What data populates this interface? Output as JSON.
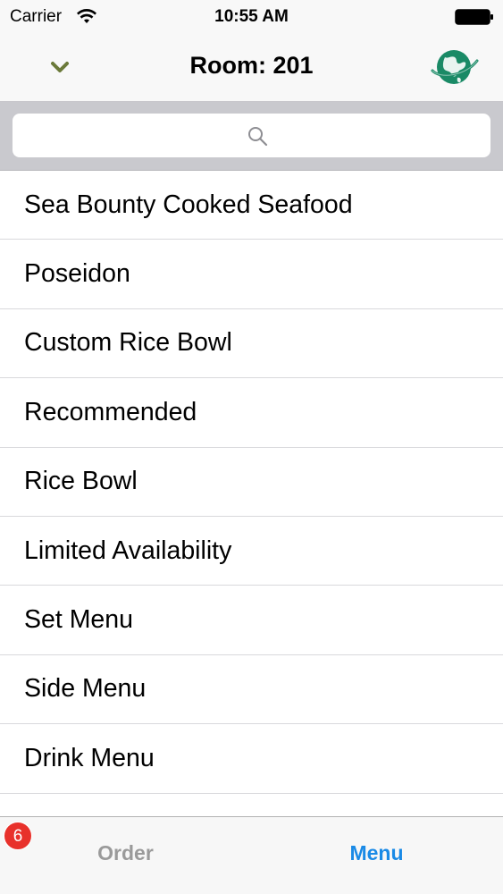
{
  "status_bar": {
    "carrier": "Carrier",
    "time": "10:55 AM",
    "wifi_icon": "wifi-icon",
    "battery_icon": "battery-icon"
  },
  "nav_bar": {
    "title": "Room: 201",
    "left_icon": "chevron-down-icon",
    "right_icon": "globe-icon",
    "chevron_color": "#6b7a3a",
    "globe_color": "#1a8a66"
  },
  "search": {
    "placeholder": "",
    "icon": "search-icon"
  },
  "menu_categories": [
    {
      "label": "Sea Bounty Cooked Seafood"
    },
    {
      "label": "Poseidon"
    },
    {
      "label": "Custom Rice Bowl"
    },
    {
      "label": "Recommended"
    },
    {
      "label": "Rice Bowl"
    },
    {
      "label": "Limited Availability"
    },
    {
      "label": "Set Menu"
    },
    {
      "label": "Side Menu"
    },
    {
      "label": "Drink Menu"
    }
  ],
  "tab_bar": {
    "order_label": "Order",
    "order_badge": "6",
    "menu_label": "Menu",
    "active_tab": "Menu",
    "active_color": "#1a8ae6",
    "inactive_color": "#9a9a9a",
    "badge_color": "#e8312b"
  }
}
